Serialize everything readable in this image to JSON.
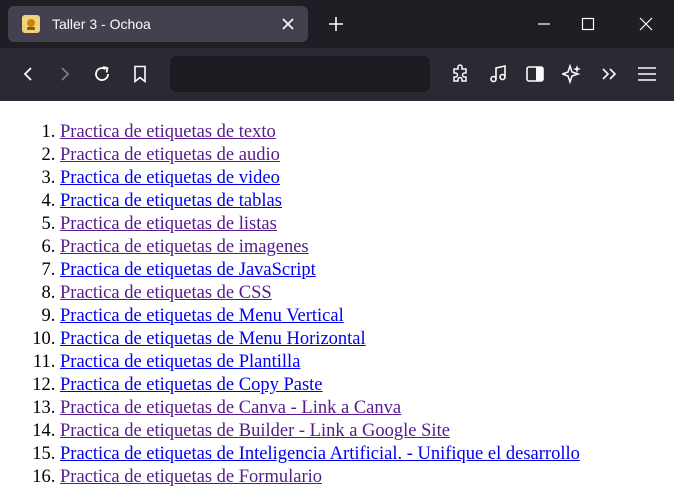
{
  "browser": {
    "tab_title": "Taller 3 - Ochoa",
    "url_value": "",
    "colors": {
      "frame": "#1f1e25",
      "tab_active": "#42414d",
      "toolbar": "#2b2a33",
      "urlbar": "#1c1b22",
      "icon": "#fbfbfe"
    }
  },
  "page": {
    "link_colors": {
      "visited": "#551a8b",
      "unvisited": "#0000ee"
    },
    "links": [
      {
        "label": "Practica de etiquetas de texto",
        "state": "visited"
      },
      {
        "label": "Practica de etiquetas de audio",
        "state": "visited"
      },
      {
        "label": "Practica de etiquetas de video",
        "state": "unvisited"
      },
      {
        "label": "Practica de etiquetas de tablas",
        "state": "unvisited"
      },
      {
        "label": "Practica de etiquetas de listas",
        "state": "visited"
      },
      {
        "label": "Practica de etiquetas de imagenes",
        "state": "visited"
      },
      {
        "label": "Practica de etiquetas de JavaScript",
        "state": "unvisited"
      },
      {
        "label": "Practica de etiquetas de CSS",
        "state": "visited"
      },
      {
        "label": "Practica de etiquetas de Menu Vertical",
        "state": "unvisited"
      },
      {
        "label": "Practica de etiquetas de Menu Horizontal",
        "state": "unvisited"
      },
      {
        "label": "Practica de etiquetas de Plantilla",
        "state": "unvisited"
      },
      {
        "label": "Practica de etiquetas de Copy Paste",
        "state": "unvisited"
      },
      {
        "label": "Practica de etiquetas de Canva - Link a Canva",
        "state": "visited"
      },
      {
        "label": "Practica de etiquetas de Builder - Link a Google Site",
        "state": "visited"
      },
      {
        "label": "Practica de etiquetas de Inteligencia Artificial. - Unifique el desarrollo",
        "state": "unvisited"
      },
      {
        "label": "Practica de etiquetas de Formulario",
        "state": "visited"
      }
    ]
  }
}
